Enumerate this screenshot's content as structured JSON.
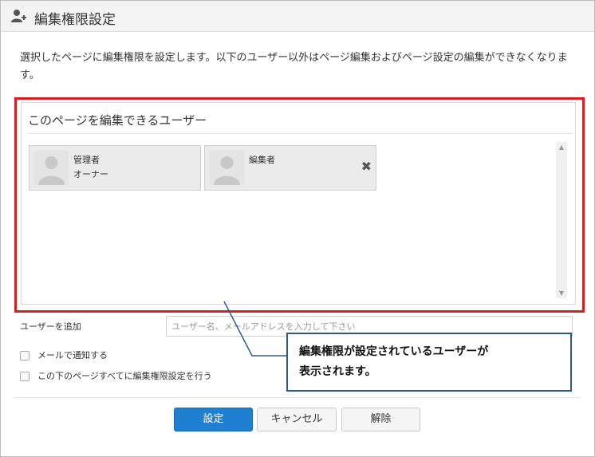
{
  "dialog": {
    "title": "編集権限設定",
    "description": "選択したページに編集権限を設定します。以下のユーザー以外はページ編集およびページ設定の編集ができなくなります。"
  },
  "panel": {
    "title": "このページを編集できるユーザー",
    "users": [
      {
        "name": "管理者",
        "role": "オーナー",
        "removable": false
      },
      {
        "name": "編集者",
        "role": "",
        "removable": true
      }
    ]
  },
  "add_user": {
    "label": "ユーザーを追加",
    "placeholder": "ユーザー名、メールアドレスを入力して下さい"
  },
  "options": {
    "notify_email": "メールで通知する",
    "apply_subpages": "この下のページすべてに編集権限設定を行う"
  },
  "buttons": {
    "ok": "設定",
    "cancel": "キャンセル",
    "clear": "解除"
  },
  "callout": {
    "line1": "編集権限が設定されているユーザーが",
    "line2": "表示されます。"
  },
  "icons": {
    "title": "user-add-icon",
    "avatar": "avatar-placeholder-icon",
    "remove": "close-icon",
    "scroll_up": "triangle-up-icon",
    "scroll_down": "triangle-down-icon"
  },
  "colors": {
    "primary_button": "#1f7fd1",
    "highlight_frame": "#d81e1e",
    "callout_border": "#2e5a8a"
  }
}
